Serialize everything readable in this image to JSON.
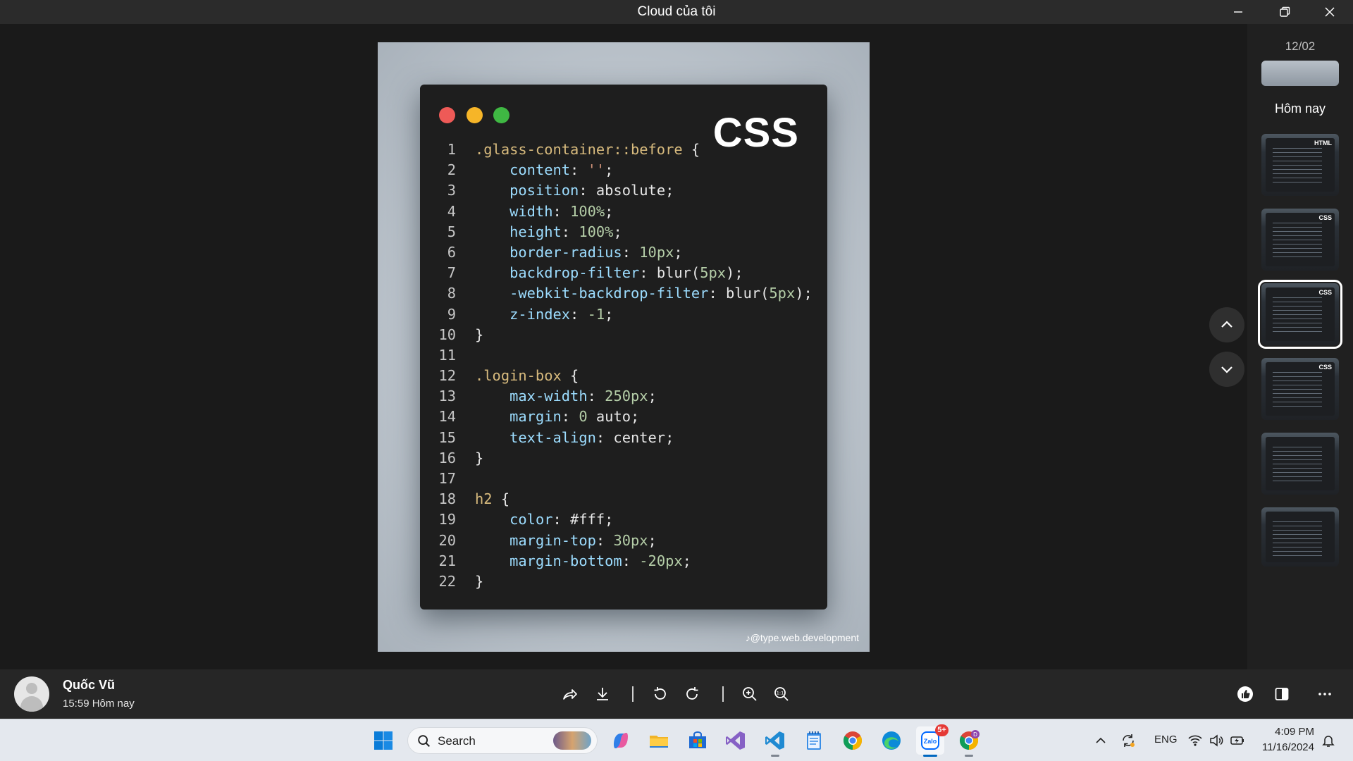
{
  "window": {
    "title": "Cloud của tôi"
  },
  "viewer": {
    "code_image": {
      "language_badge": "CSS",
      "watermark": "@type.web.development",
      "lines": [
        [
          {
            "t": "sel",
            "v": ".glass-container::before"
          },
          {
            "t": "punc",
            "v": " {"
          }
        ],
        [
          {
            "t": "sp",
            "v": "    "
          },
          {
            "t": "prop",
            "v": "content"
          },
          {
            "t": "punc",
            "v": ": "
          },
          {
            "t": "str",
            "v": "''"
          },
          {
            "t": "punc",
            "v": ";"
          }
        ],
        [
          {
            "t": "sp",
            "v": "    "
          },
          {
            "t": "prop",
            "v": "position"
          },
          {
            "t": "punc",
            "v": ": absolute;"
          }
        ],
        [
          {
            "t": "sp",
            "v": "    "
          },
          {
            "t": "prop",
            "v": "width"
          },
          {
            "t": "punc",
            "v": ": "
          },
          {
            "t": "num",
            "v": "100%"
          },
          {
            "t": "punc",
            "v": ";"
          }
        ],
        [
          {
            "t": "sp",
            "v": "    "
          },
          {
            "t": "prop",
            "v": "height"
          },
          {
            "t": "punc",
            "v": ": "
          },
          {
            "t": "num",
            "v": "100%"
          },
          {
            "t": "punc",
            "v": ";"
          }
        ],
        [
          {
            "t": "sp",
            "v": "    "
          },
          {
            "t": "prop",
            "v": "border-radius"
          },
          {
            "t": "punc",
            "v": ": "
          },
          {
            "t": "num",
            "v": "10px"
          },
          {
            "t": "punc",
            "v": ";"
          }
        ],
        [
          {
            "t": "sp",
            "v": "    "
          },
          {
            "t": "prop",
            "v": "backdrop-filter"
          },
          {
            "t": "punc",
            "v": ": blur("
          },
          {
            "t": "num",
            "v": "5px"
          },
          {
            "t": "punc",
            "v": ");"
          }
        ],
        [
          {
            "t": "sp",
            "v": "    "
          },
          {
            "t": "prop",
            "v": "-webkit-backdrop-filter"
          },
          {
            "t": "punc",
            "v": ": blur("
          },
          {
            "t": "num",
            "v": "5px"
          },
          {
            "t": "punc",
            "v": ");"
          }
        ],
        [
          {
            "t": "sp",
            "v": "    "
          },
          {
            "t": "prop",
            "v": "z-index"
          },
          {
            "t": "punc",
            "v": ": "
          },
          {
            "t": "num",
            "v": "-1"
          },
          {
            "t": "punc",
            "v": ";"
          }
        ],
        [
          {
            "t": "punc",
            "v": "}"
          }
        ],
        [],
        [
          {
            "t": "sel",
            "v": ".login-box"
          },
          {
            "t": "punc",
            "v": " {"
          }
        ],
        [
          {
            "t": "sp",
            "v": "    "
          },
          {
            "t": "prop",
            "v": "max-width"
          },
          {
            "t": "punc",
            "v": ": "
          },
          {
            "t": "num",
            "v": "250px"
          },
          {
            "t": "punc",
            "v": ";"
          }
        ],
        [
          {
            "t": "sp",
            "v": "    "
          },
          {
            "t": "prop",
            "v": "margin"
          },
          {
            "t": "punc",
            "v": ": "
          },
          {
            "t": "num",
            "v": "0"
          },
          {
            "t": "punc",
            "v": " auto;"
          }
        ],
        [
          {
            "t": "sp",
            "v": "    "
          },
          {
            "t": "prop",
            "v": "text-align"
          },
          {
            "t": "punc",
            "v": ": center;"
          }
        ],
        [
          {
            "t": "punc",
            "v": "}"
          }
        ],
        [],
        [
          {
            "t": "sel",
            "v": "h2"
          },
          {
            "t": "punc",
            "v": " {"
          }
        ],
        [
          {
            "t": "sp",
            "v": "    "
          },
          {
            "t": "prop",
            "v": "color"
          },
          {
            "t": "punc",
            "v": ": #fff;"
          }
        ],
        [
          {
            "t": "sp",
            "v": "    "
          },
          {
            "t": "prop",
            "v": "margin-top"
          },
          {
            "t": "punc",
            "v": ": "
          },
          {
            "t": "num",
            "v": "30px"
          },
          {
            "t": "punc",
            "v": ";"
          }
        ],
        [
          {
            "t": "sp",
            "v": "    "
          },
          {
            "t": "prop",
            "v": "margin-bottom"
          },
          {
            "t": "punc",
            "v": ": "
          },
          {
            "t": "num",
            "v": "-20px"
          },
          {
            "t": "punc",
            "v": ";"
          }
        ],
        [
          {
            "t": "punc",
            "v": "}"
          }
        ]
      ]
    },
    "nav_up_icon": "chevron-up-icon",
    "nav_down_icon": "chevron-down-icon"
  },
  "strip": {
    "date_label": "12/02",
    "today_label": "Hôm nay",
    "thumbs": [
      {
        "tag": "HTML"
      },
      {
        "tag": "CSS"
      },
      {
        "tag": "CSS",
        "active": true
      },
      {
        "tag": "CSS"
      },
      {
        "tag": ""
      },
      {
        "tag": ""
      }
    ]
  },
  "bottom": {
    "sender_name": "Quốc Vũ",
    "sent_time": "15:59 Hôm nay",
    "tools": [
      "share-icon",
      "download-icon",
      "rotate-left-icon",
      "rotate-right-icon",
      "zoom-in-icon",
      "zoom-reset-icon"
    ],
    "right_tools": [
      "like-icon",
      "side-panel-icon",
      "more-icon"
    ]
  },
  "taskbar": {
    "search_label": "Search",
    "lang": "ENG",
    "time": "4:09 PM",
    "date": "11/16/2024",
    "zalo_badge": "5+",
    "colors": {
      "accent": "#0067c0",
      "badge": "#e53935"
    }
  }
}
